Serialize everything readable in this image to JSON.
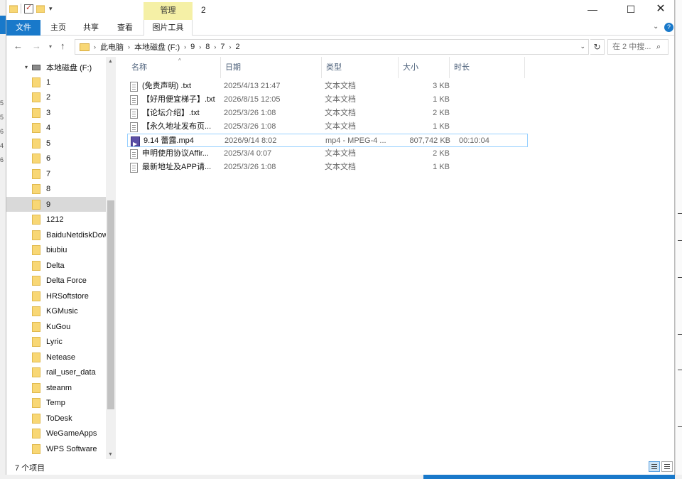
{
  "window": {
    "title": "2",
    "context_tab_group": "管理",
    "minimize": "—",
    "maximize": "☐",
    "close": "✕"
  },
  "ribbon": {
    "tabs": [
      {
        "label": "文件",
        "active": true
      },
      {
        "label": "主页"
      },
      {
        "label": "共享"
      },
      {
        "label": "查看"
      },
      {
        "label": "图片工具"
      }
    ],
    "help": "?"
  },
  "address": {
    "crumbs": [
      "此电脑",
      "本地磁盘 (F:)",
      "9",
      "8",
      "7",
      "2"
    ],
    "search_placeholder": "在 2 中搜..."
  },
  "nav_pane": {
    "drive": "本地磁盘 (F:)",
    "folders": [
      "1",
      "2",
      "3",
      "4",
      "5",
      "6",
      "7",
      "8",
      "9",
      "1212",
      "BaiduNetdiskDownload",
      "biubiu",
      "Delta",
      "Delta Force",
      "HRSoftstore",
      "KGMusic",
      "KuGou",
      "Lyric",
      "Netease",
      "rail_user_data",
      "steanm",
      "Temp",
      "ToDesk",
      "WeGameApps",
      "WPS Software"
    ],
    "selected": "9"
  },
  "columns": {
    "name": "名称",
    "date": "日期",
    "type": "类型",
    "size": "大小",
    "duration": "时长"
  },
  "files": [
    {
      "name": "(免责声明) .txt",
      "date": "2025/4/13 21:47",
      "type": "文本文档",
      "size": "3 KB",
      "duration": "",
      "icon": "text-file-icon"
    },
    {
      "name": "【好用便宜梯子】.txt",
      "date": "2026/8/15 12:05",
      "type": "文本文档",
      "size": "1 KB",
      "duration": "",
      "icon": "text-file-icon"
    },
    {
      "name": "【论坛介绍】.txt",
      "date": "2025/3/26 1:08",
      "type": "文本文档",
      "size": "2 KB",
      "duration": "",
      "icon": "text-file-icon"
    },
    {
      "name": "【永久地址发布页...",
      "date": "2025/3/26 1:08",
      "type": "文本文档",
      "size": "1 KB",
      "duration": "",
      "icon": "text-file-icon"
    },
    {
      "name": "9.14 蕾露.mp4",
      "date": "2026/9/14 8:02",
      "type": "mp4 - MPEG-4 ...",
      "size": "807,742 KB",
      "duration": "00:10:04",
      "icon": "video-file-icon",
      "selected": true
    },
    {
      "name": "申明使用协议Affir...",
      "date": "2025/3/4 0:07",
      "type": "文本文档",
      "size": "2 KB",
      "duration": "",
      "icon": "text-file-icon"
    },
    {
      "name": "最新地址及APP请...",
      "date": "2025/3/26 1:08",
      "type": "文本文档",
      "size": "1 KB",
      "duration": "",
      "icon": "text-file-icon"
    }
  ],
  "status": {
    "item_count": "7 个项目"
  },
  "background": {
    "left_digits": [
      "5",
      "5",
      "6",
      "4",
      "6"
    ]
  },
  "colors": {
    "accent": "#1979ca",
    "context_tab": "#f5f0a6",
    "folder": "#f8d775",
    "selection_border": "#99d1ff"
  }
}
